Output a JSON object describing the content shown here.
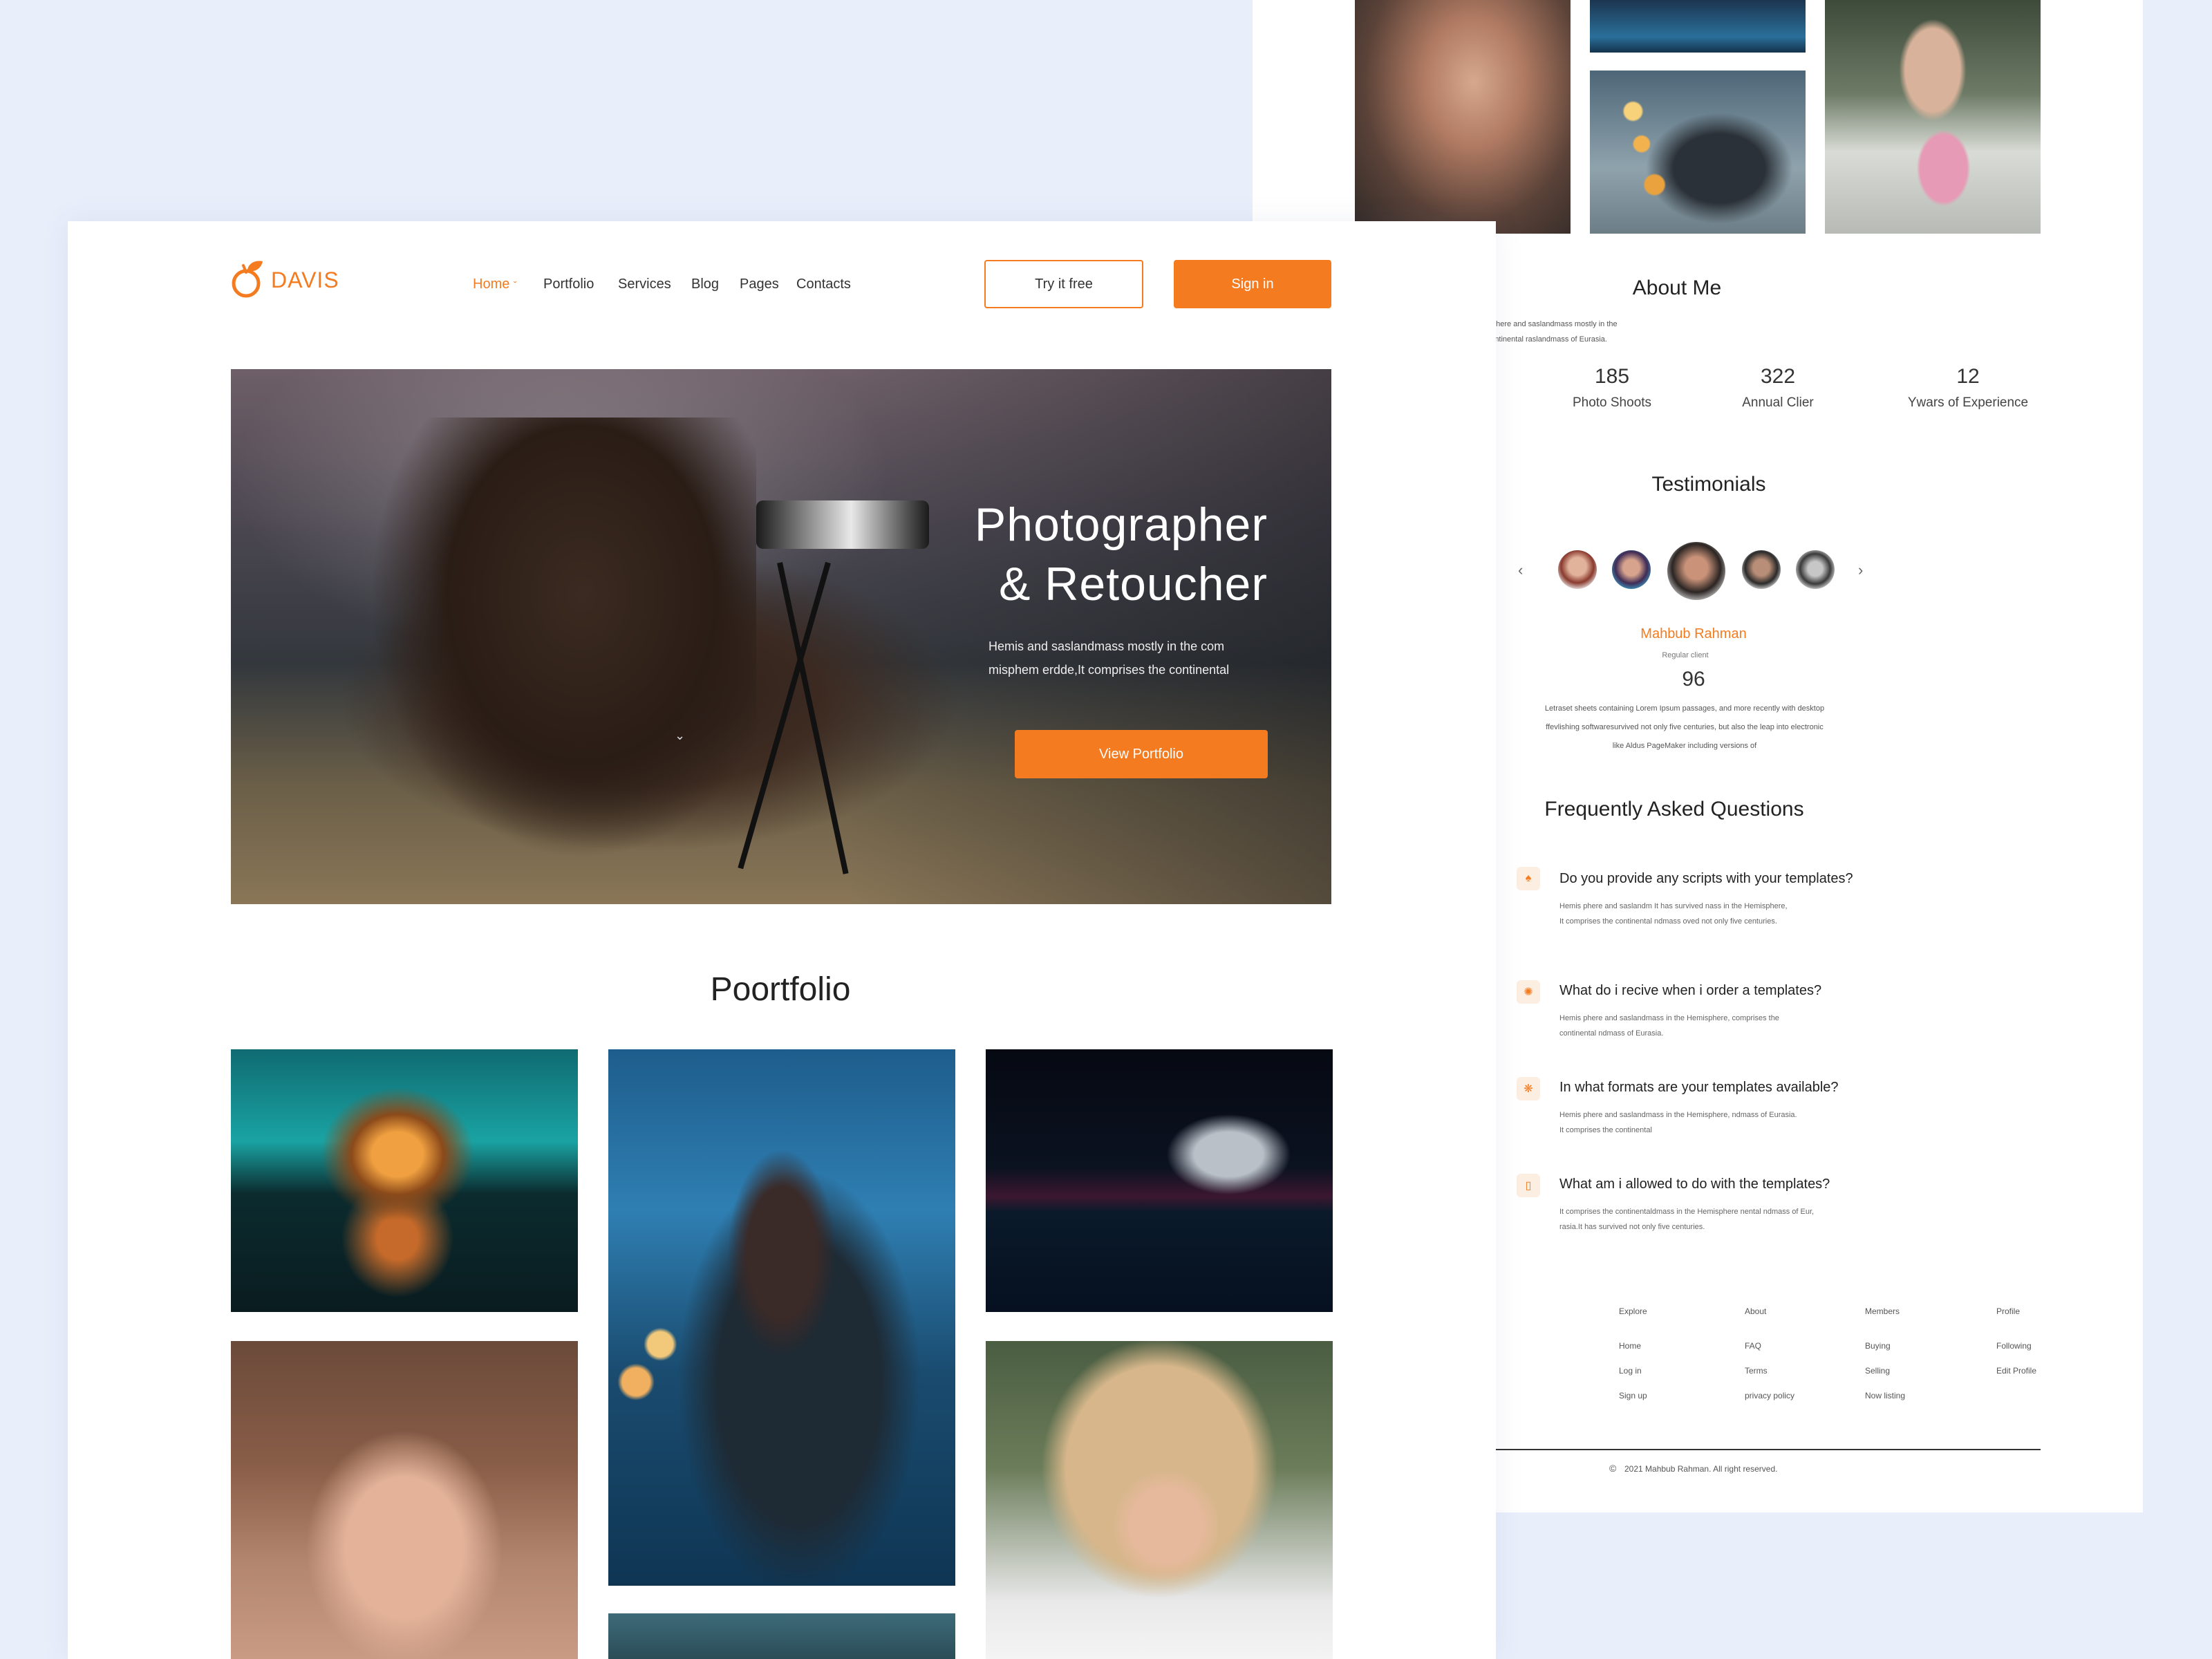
{
  "header": {
    "brand": "DAVIS",
    "nav": [
      "Home",
      "Portfolio",
      "Services",
      "Blog",
      "Pages",
      "Contacts"
    ],
    "try_label": "Try it free",
    "signin_label": "Sign in"
  },
  "hero": {
    "title_line1": "Photographer",
    "title_line2": "& Retoucher",
    "desc_line1": "Hemis  and saslandmass mostly in the  com",
    "desc_line2": "misphem erdde,It comprises the continental",
    "cta_label": "View  Portfolio"
  },
  "portfolio": {
    "title": "Poortfolio"
  },
  "about": {
    "title": "About Me",
    "text_line1": "phere and saslandmass mostly in the  com Eastern Hemisphere,Hemis phere and saslandmass mostly in the",
    "text_line2": "m  comprises the continental raslandmass of Eurasia.It comprises the continental raslandmass of Eurasia.",
    "stats": [
      {
        "value": "185",
        "label": "Photo Shoots"
      },
      {
        "value": "322",
        "label": "Annual Clier"
      },
      {
        "value": "12",
        "label": "Ywars of Experience"
      }
    ]
  },
  "testimonials": {
    "title": "Testimonials",
    "name": "Mahbub Rahman",
    "role": "Regular client",
    "score": "96",
    "text_line1": "Letraset sheets containing Lorem Ipsum passages, and more recently with desktop",
    "text_line2": "ffevlishing softwaresurvived not only five centuries, but also the leap into electronic",
    "text_line3": "like Aldus PageMaker including versions of"
  },
  "faq": {
    "title": "Frequently Asked Questions",
    "items": [
      {
        "q": "Do you provide any scripts with your templates?",
        "a1": "Hemis phere and saslandm It has survived nass in the Hemisphere,",
        "a2": "It comprises the continental ndmass oved not only five centuries."
      },
      {
        "q": "What do i recive when i order a templates?",
        "a1": "Hemis phere and saslandmass in the Hemisphere, comprises the",
        "a2": "continental ndmass of Eurasia."
      },
      {
        "q": "In what formats are your templates available?",
        "a1": "Hemis phere and saslandmass in the Hemisphere,  ndmass of Eurasia.",
        "a2": "It comprises the continental"
      },
      {
        "q": "What am i allowed to do with the templates?",
        "a1": "It comprises the continentaldmass in the Hemisphere nental ndmass of Eur,",
        "a2": "rasia.It has survived not only five centuries."
      }
    ]
  },
  "footer": {
    "columns": [
      {
        "heading": "Explore",
        "links": [
          "Home",
          "Log in",
          "Sign up"
        ]
      },
      {
        "heading": "About",
        "links": [
          "FAQ",
          "Terms",
          "privacy policy"
        ]
      },
      {
        "heading": "Members",
        "links": [
          "Buying",
          "Selling",
          "Now listing"
        ]
      },
      {
        "heading": "Profile",
        "links": [
          "Following",
          "Edit Profile"
        ]
      }
    ],
    "copyright": "2021 Mahbub Rahman. All right reserved."
  },
  "colors": {
    "accent": "#f47b20",
    "background": "#e9eefb"
  },
  "icons": [
    "leaf-logo-icon",
    "chevron-down-icon",
    "chevron-left-icon",
    "chevron-right-icon",
    "copyright-icon"
  ]
}
